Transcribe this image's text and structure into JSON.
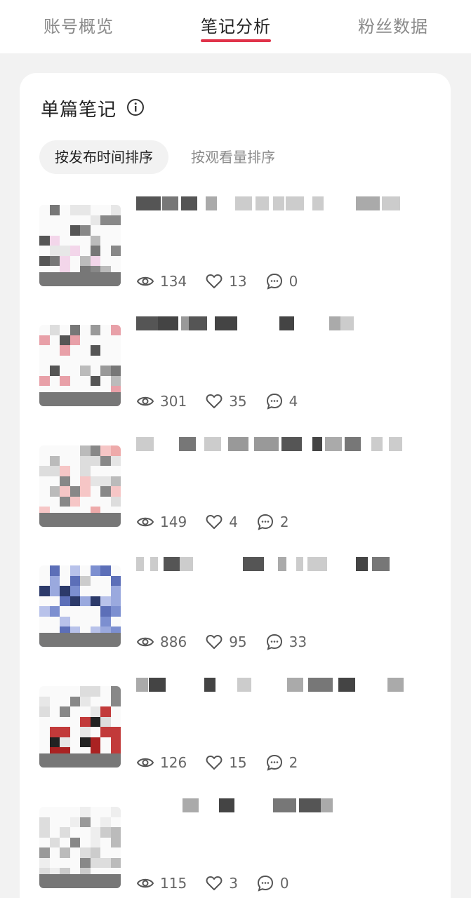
{
  "tabs": [
    {
      "label": "账号概览",
      "active": false
    },
    {
      "label": "笔记分析",
      "active": true
    },
    {
      "label": "粉丝数据",
      "active": false
    }
  ],
  "section": {
    "title": "单篇笔记",
    "info_icon": "info-circle-icon"
  },
  "sort": [
    {
      "label": "按发布时间排序",
      "active": true
    },
    {
      "label": "按观看量排序",
      "active": false
    }
  ],
  "notes": [
    {
      "views": "134",
      "likes": "13",
      "comments": "0"
    },
    {
      "views": "301",
      "likes": "35",
      "comments": "4"
    },
    {
      "views": "149",
      "likes": "4",
      "comments": "2"
    },
    {
      "views": "886",
      "likes": "95",
      "comments": "33"
    },
    {
      "views": "126",
      "likes": "15",
      "comments": "2"
    },
    {
      "views": "115",
      "likes": "3",
      "comments": "0"
    }
  ],
  "icons": {
    "views": "eye-icon",
    "likes": "heart-icon",
    "comments": "comment-icon"
  },
  "colors": {
    "accent": "#e0334a",
    "card": "#ffffff",
    "background": "#f2f2f2"
  }
}
